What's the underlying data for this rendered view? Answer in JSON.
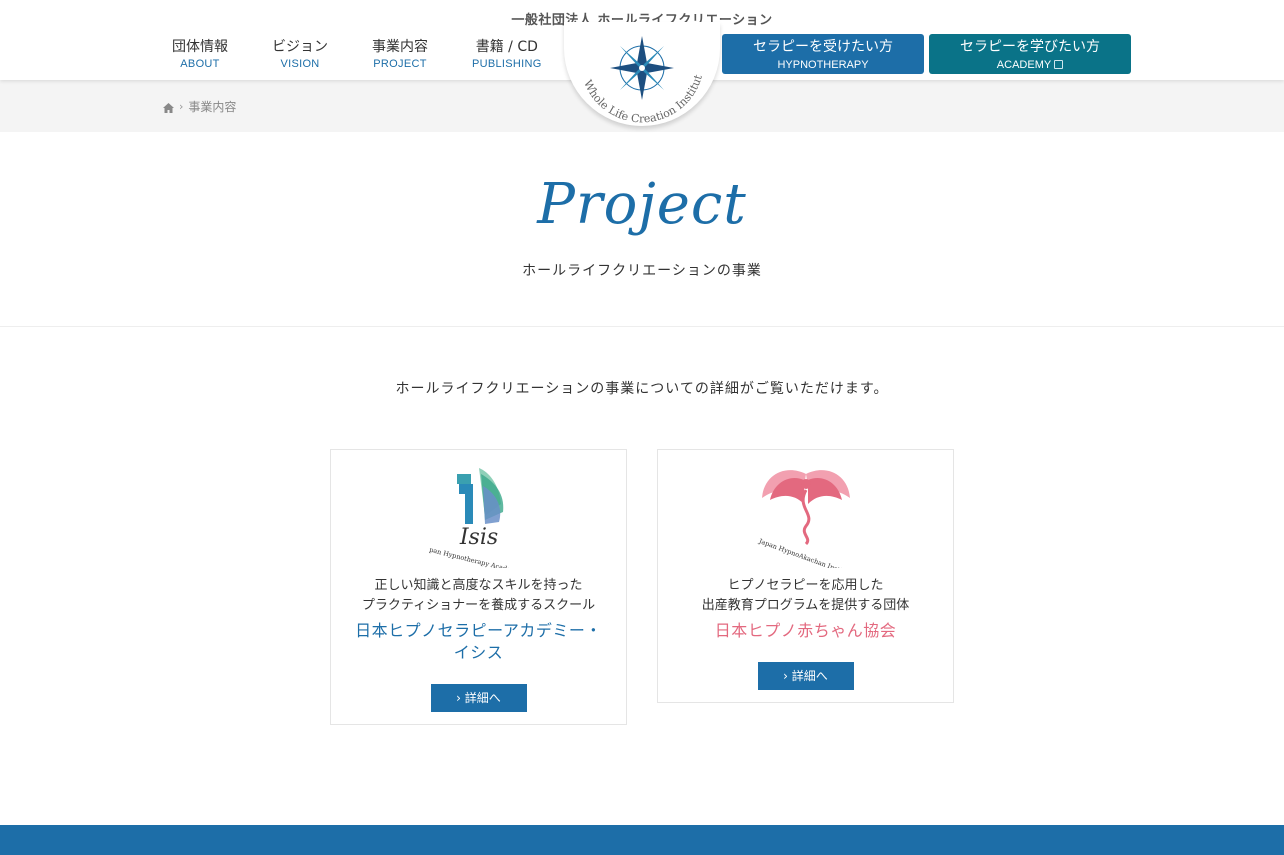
{
  "header": {
    "org_name": "一般社団法人 ホールライフクリエーション",
    "logo_text": "Whole Life Creation Institute",
    "nav": [
      {
        "ja": "団体情報",
        "en": "ABOUT"
      },
      {
        "ja": "ビジョン",
        "en": "VISION"
      },
      {
        "ja": "事業内容",
        "en": "PROJECT"
      },
      {
        "ja": "書籍 / CD",
        "en": "PUBLISHING"
      }
    ],
    "cta_hypno": {
      "ja": "セラピーを受けたい方",
      "en": "HYPNOTHERAPY"
    },
    "cta_academy": {
      "ja": "セラピーを学びたい方",
      "en": "ACADEMY"
    }
  },
  "breadcrumb": {
    "current": "事業内容"
  },
  "title": {
    "script": "Project",
    "subtitle": "ホールライフクリエーションの事業"
  },
  "intro": "ホールライフクリエーションの事業についての詳細がご覧いただけます。",
  "cards": [
    {
      "logo_word": "Isis",
      "logo_caption": "Japan Hypnotherapy Academy ISIS",
      "desc1": "正しい知識と高度なスキルを持った",
      "desc2": "プラクティショナーを養成するスクール",
      "name1": "日本ヒプノセラピーアカデミー・",
      "name2": "イシス",
      "button": "詳細へ",
      "color": "#1d6ea8"
    },
    {
      "logo_caption": "Japan HypnoAkachan Institute",
      "desc1": "ヒプノセラピーを応用した",
      "desc2": "出産教育プログラムを提供する団体",
      "name1": "日本ヒプノ赤ちゃん協会",
      "button": "詳細へ",
      "color": "#e3697f"
    }
  ],
  "colors": {
    "primary": "#1d6ea8",
    "academy": "#0a7388",
    "pink": "#e3697f",
    "breadcrumb_bg": "#f4f4f4"
  },
  "icons": [
    "home-icon",
    "chevron-right-icon",
    "external-link-icon",
    "compass-star-icon"
  ]
}
